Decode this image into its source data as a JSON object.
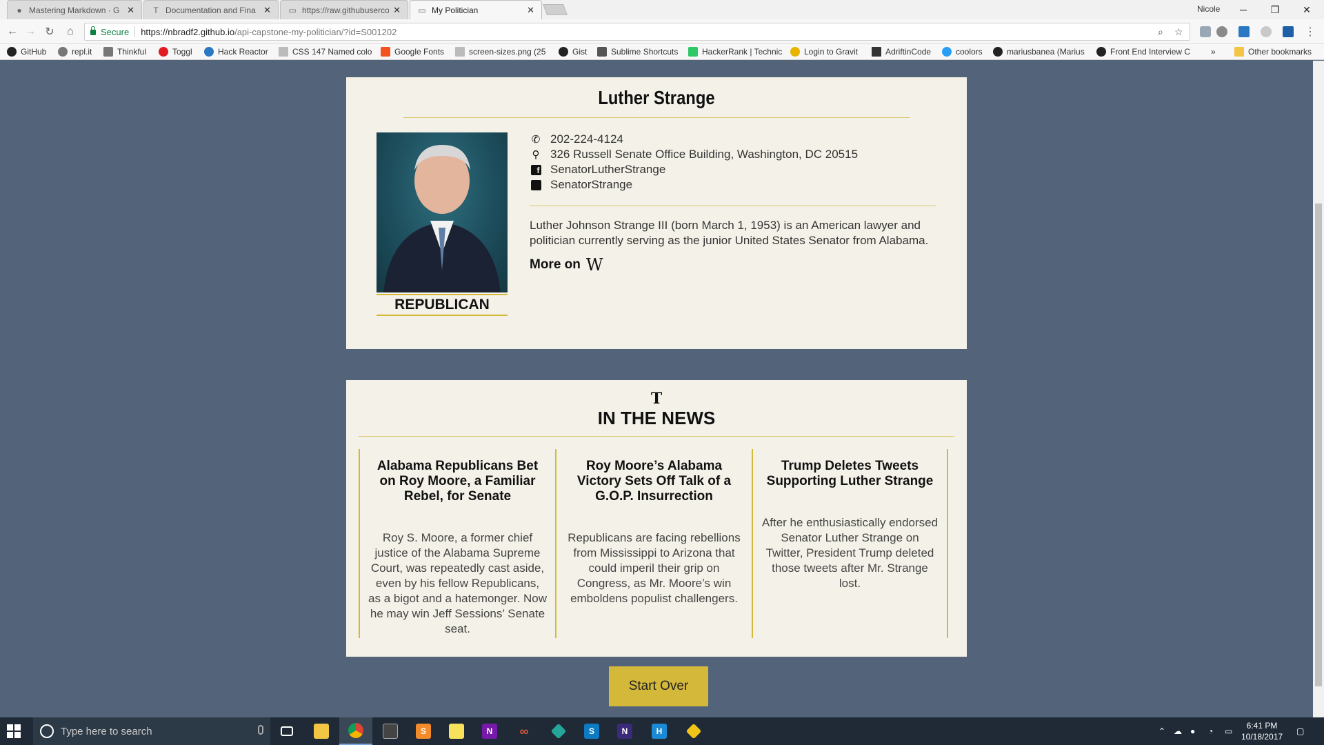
{
  "browser": {
    "tabs": [
      {
        "title": "Mastering Markdown · G",
        "icon": "github-icon"
      },
      {
        "title": "Documentation and Fina",
        "icon": "thinkful-icon"
      },
      {
        "title": "https://raw.githubuserco",
        "icon": "page-icon"
      },
      {
        "title": "My Politician",
        "icon": "page-icon"
      }
    ],
    "profile_name": "Nicole",
    "secure_label": "Secure",
    "url_host": "https://nbradf2.github.io",
    "url_path": "/api-capstone-my-politician/?id=S001202",
    "bookmarks": [
      {
        "label": "GitHub",
        "color": "#222222"
      },
      {
        "label": "repl.it",
        "color": "#555555"
      },
      {
        "label": "Thinkful",
        "color": "#666666"
      },
      {
        "label": "Toggl",
        "color": "#e01b22"
      },
      {
        "label": "Hack Reactor",
        "color": "#2a78c2"
      },
      {
        "label": "CSS 147 Named colo",
        "color": "#999999"
      },
      {
        "label": "Google Fonts",
        "color": "#f4511e"
      },
      {
        "label": "screen-sizes.png (25",
        "color": "#999999"
      },
      {
        "label": "Gist",
        "color": "#222222"
      },
      {
        "label": "Sublime Shortcuts",
        "color": "#555555"
      },
      {
        "label": "HackerRank | Technic",
        "color": "#2ec866"
      },
      {
        "label": "Login to Gravit",
        "color": "#e8b400"
      },
      {
        "label": "AdriftinCode",
        "color": "#333333"
      },
      {
        "label": "coolors",
        "color": "#2a9df4"
      },
      {
        "label": "mariusbanea (Marius",
        "color": "#222222"
      },
      {
        "label": "Front End Interview C",
        "color": "#222222"
      }
    ],
    "other_bookmarks": "Other bookmarks"
  },
  "politician": {
    "name": "Luther Strange",
    "party": "REPUBLICAN",
    "phone": "202-224-4124",
    "address": "326 Russell Senate Office Building, Washington, DC 20515",
    "facebook": "SenatorLutherStrange",
    "twitter": "SenatorStrange",
    "bio": "Luther Johnson Strange III (born March 1, 1953) is an American lawyer and politician currently serving as the junior United States Senator from Alabama.",
    "more_label": "More on",
    "wiki_glyph": "W"
  },
  "news": {
    "logo_glyph": "T",
    "heading": "IN THE NEWS",
    "articles": [
      {
        "headline": "Alabama Republicans Bet on Roy Moore, a Familiar Rebel, for Senate",
        "summary": "Roy S. Moore, a former chief justice of the Alabama Supreme Court, was repeatedly cast aside, even by his fellow Republicans, as a bigot and a hatemonger. Now he may win Jeff Sessions’ Senate seat."
      },
      {
        "headline": "Roy Moore’s Alabama Victory Sets Off Talk of a G.O.P. Insurrection",
        "summary": "Republicans are facing rebellions from Mississippi to Arizona that could imperil their grip on Congress, as Mr. Moore’s win emboldens populist challengers."
      },
      {
        "headline": "Trump Deletes Tweets Supporting Luther Strange",
        "summary": "After he enthusiastically endorsed Senator Luther Strange on Twitter, President Trump deleted those tweets after Mr. Strange lost."
      }
    ]
  },
  "start_over_label": "Start Over",
  "taskbar": {
    "search_placeholder": "Type here to search",
    "time": "6:41 PM",
    "date": "10/18/2017"
  },
  "colors": {
    "page_bg": "#53647a",
    "card_bg": "#f4f2e8",
    "accent_gold": "#d4b83a"
  }
}
